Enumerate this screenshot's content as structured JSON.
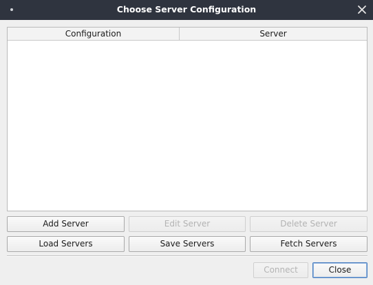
{
  "window": {
    "title": "Choose Server Configuration"
  },
  "table": {
    "columns": [
      "Configuration",
      "Server"
    ],
    "rows": []
  },
  "buttons": {
    "add_server": "Add Server",
    "edit_server": "Edit Server",
    "delete_server": "Delete Server",
    "load_servers": "Load Servers",
    "save_servers": "Save Servers",
    "fetch_servers": "Fetch Servers",
    "connect": "Connect",
    "close": "Close"
  },
  "state": {
    "edit_server_enabled": false,
    "delete_server_enabled": false,
    "connect_enabled": false,
    "focused_button": "close"
  },
  "icons": {
    "window_menu": "window-menu-dot-icon",
    "window_close": "close-icon"
  },
  "colors": {
    "titlebar_bg": "#2f343f",
    "dialog_bg": "#efefef",
    "focus_border": "#4a7fc1"
  }
}
